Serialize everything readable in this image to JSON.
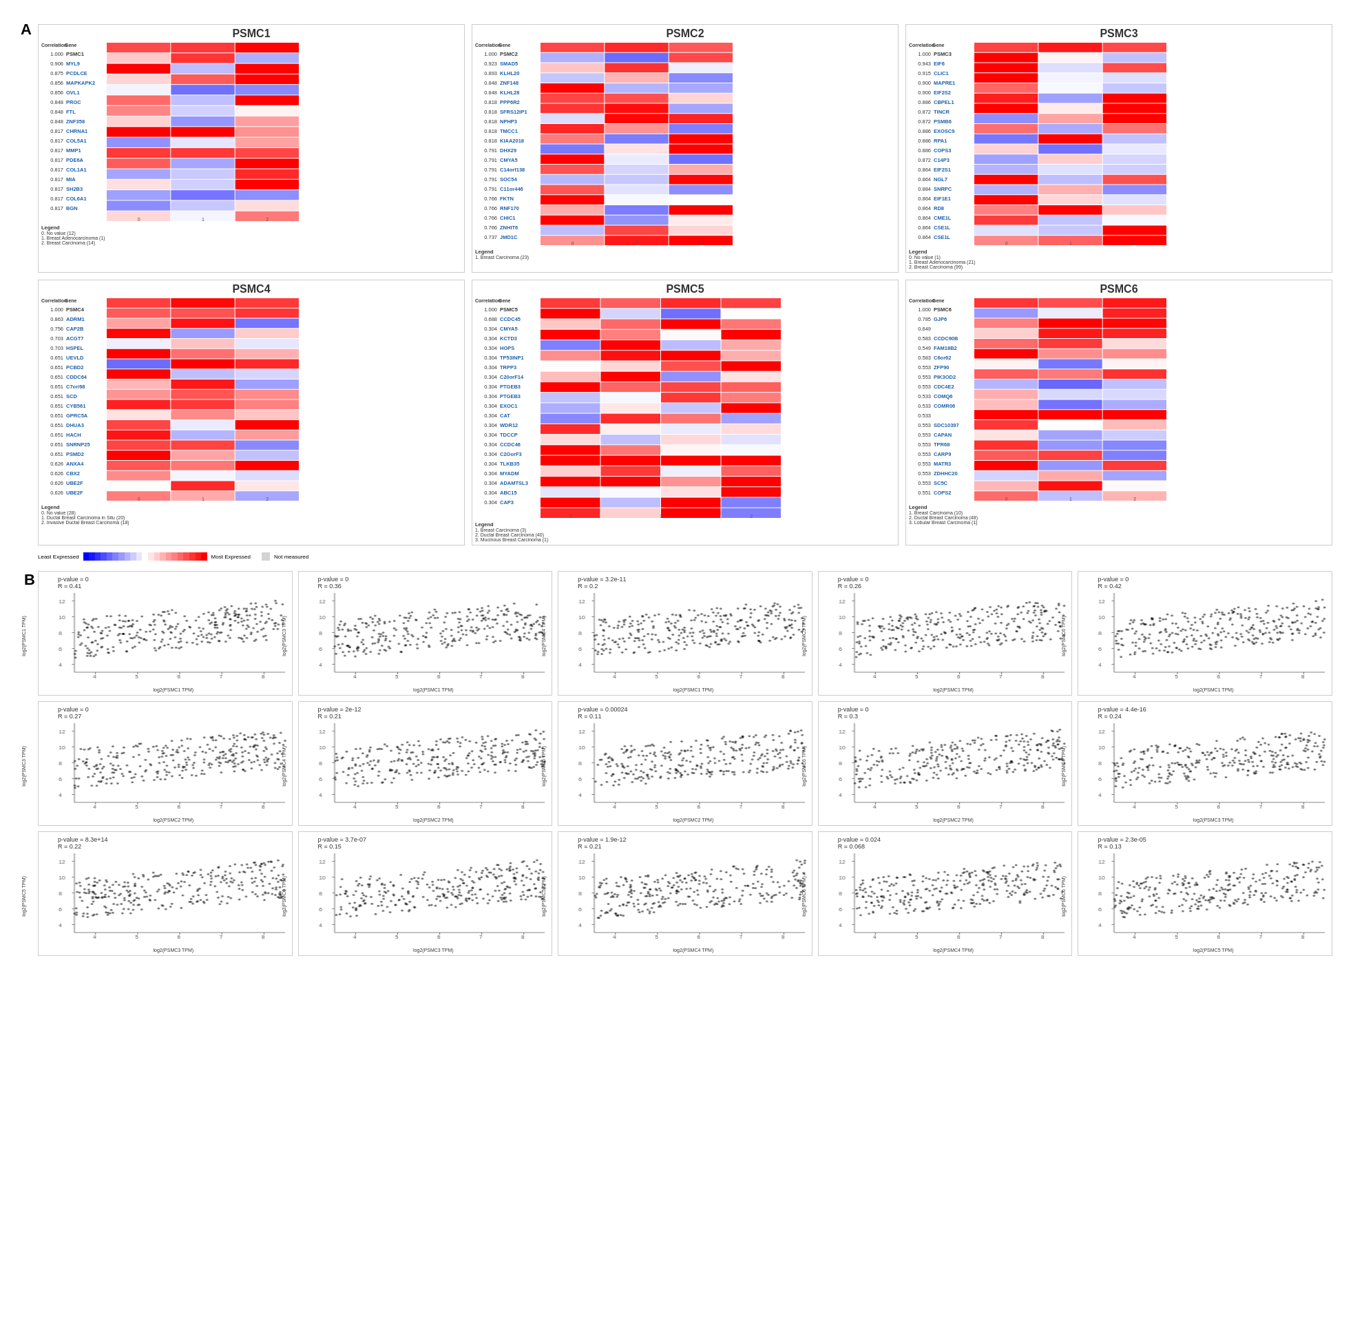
{
  "sectionA": {
    "label": "A",
    "heatmaps": [
      {
        "title": "PSMC1",
        "genes": [
          {
            "corr": "1.000",
            "name": "PSMC1"
          },
          {
            "corr": "0.906",
            "name": "MYL9"
          },
          {
            "corr": "0.875",
            "name": "PCDLCE"
          },
          {
            "corr": "0.856",
            "name": "MAPKAPK2"
          },
          {
            "corr": "0.856",
            "name": "OVL1"
          },
          {
            "corr": "0.848",
            "name": "PROC"
          },
          {
            "corr": "0.848",
            "name": "FTL"
          },
          {
            "corr": "0.848",
            "name": "ZNF358"
          },
          {
            "corr": "0.817",
            "name": "CHRNA1"
          },
          {
            "corr": "0.817",
            "name": "COL5A1"
          },
          {
            "corr": "0.817",
            "name": "MMP1"
          },
          {
            "corr": "0.817",
            "name": "PDE6A"
          },
          {
            "corr": "0.817",
            "name": "COL1A1"
          },
          {
            "corr": "0.817",
            "name": "MIA"
          },
          {
            "corr": "0.817",
            "name": "SH2B3"
          },
          {
            "corr": "0.817",
            "name": "COL6A1"
          },
          {
            "corr": "0.817",
            "name": "BGN"
          }
        ],
        "legend": [
          "0. No value (12)",
          "1. Breast Adenocarcinoma (1)",
          "2. Breast Carcinoma (14)"
        ],
        "cols": 3
      },
      {
        "title": "PSMC2",
        "genes": [
          {
            "corr": "1.000",
            "name": "PSMC2"
          },
          {
            "corr": "0.923",
            "name": "SMAD5"
          },
          {
            "corr": "0.893",
            "name": "KLHL20"
          },
          {
            "corr": "0.848",
            "name": "ZNF148"
          },
          {
            "corr": "0.848",
            "name": "KLHL28"
          },
          {
            "corr": "0.818",
            "name": "PPP6R2"
          },
          {
            "corr": "0.818",
            "name": "SFRS12IP1"
          },
          {
            "corr": "0.818",
            "name": "NPHP3"
          },
          {
            "corr": "0.818",
            "name": "TMCC1"
          },
          {
            "corr": "0.818",
            "name": "KIAA2018"
          },
          {
            "corr": "0.791",
            "name": "DHX29"
          },
          {
            "corr": "0.791",
            "name": "CMYA5"
          },
          {
            "corr": "0.791",
            "name": "C14orf138"
          },
          {
            "corr": "0.791",
            "name": "SOC54"
          },
          {
            "corr": "0.791",
            "name": "C11or446"
          },
          {
            "corr": "0.766",
            "name": "FKTN"
          },
          {
            "corr": "0.766",
            "name": "RNF170"
          },
          {
            "corr": "0.766",
            "name": "CHIC1"
          },
          {
            "corr": "0.766",
            "name": "ZNHIT6"
          },
          {
            "corr": "0.737",
            "name": "JMD1C"
          }
        ],
        "legend": [
          "1. Breast Carcinoma (23)"
        ],
        "cols": 3
      },
      {
        "title": "PSMC3",
        "genes": [
          {
            "corr": "1.000",
            "name": "PSMC3"
          },
          {
            "corr": "0.943",
            "name": "EIF6"
          },
          {
            "corr": "0.915",
            "name": "CLIC1"
          },
          {
            "corr": "0.900",
            "name": "MAPRE1"
          },
          {
            "corr": "0.900",
            "name": "EIF2S2"
          },
          {
            "corr": "0.886",
            "name": "CBPEL1"
          },
          {
            "corr": "0.872",
            "name": "TINCR"
          },
          {
            "corr": "0.872",
            "name": "PSMB6"
          },
          {
            "corr": "0.886",
            "name": "EXOSC9"
          },
          {
            "corr": "0.886",
            "name": "RPA1"
          },
          {
            "corr": "0.886",
            "name": "COPS3"
          },
          {
            "corr": "0.872",
            "name": "C14P3"
          },
          {
            "corr": "0.864",
            "name": "EIF2S1"
          },
          {
            "corr": "0.864",
            "name": "NGL7"
          },
          {
            "corr": "0.884",
            "name": "SNRPC"
          },
          {
            "corr": "0.864",
            "name": "EIF1E1"
          },
          {
            "corr": "0.864",
            "name": "RD8"
          },
          {
            "corr": "0.864",
            "name": "CME1L"
          },
          {
            "corr": "0.864",
            "name": "CSE1L"
          },
          {
            "corr": "0.864",
            "name": "CSE1L"
          }
        ],
        "legend": [
          "0. No value (1)",
          "1. Breast Adenocarcinoma (21)",
          "2. Breast Carcinoma (99)"
        ],
        "cols": 3
      },
      {
        "title": "PSMC4",
        "genes": [
          {
            "corr": "1.000",
            "name": "PSMC4"
          },
          {
            "corr": "0.863",
            "name": "ADRM1"
          },
          {
            "corr": "0.756",
            "name": "CAP2B"
          },
          {
            "corr": "0.703",
            "name": "ACGT7"
          },
          {
            "corr": "0.703",
            "name": "HSPEL"
          },
          {
            "corr": "0.651",
            "name": "UEVLD"
          },
          {
            "corr": "0.651",
            "name": "PCBD2"
          },
          {
            "corr": "0.651",
            "name": "CDDC64"
          },
          {
            "corr": "0.651",
            "name": "C7or/68"
          },
          {
            "corr": "0.651",
            "name": "SCD"
          },
          {
            "corr": "0.651",
            "name": "CYB561"
          },
          {
            "corr": "0.651",
            "name": "GPRC5A"
          },
          {
            "corr": "0.651",
            "name": "DHUA3"
          },
          {
            "corr": "0.651",
            "name": "HACH"
          },
          {
            "corr": "0.651",
            "name": "SNRNP25"
          },
          {
            "corr": "0.651",
            "name": "PSMD2"
          },
          {
            "corr": "0.626",
            "name": "ANXA4"
          },
          {
            "corr": "0.626",
            "name": "CBX2"
          },
          {
            "corr": "0.626",
            "name": "UBE2F"
          },
          {
            "corr": "0.626",
            "name": "UBE2F"
          }
        ],
        "legend": [
          "0. No value (28)",
          "1. Ductal Breast Carcinoma in Situ (20)",
          "2. Invasive Ductal Breast Carcinoma (18)"
        ],
        "cols": 3
      },
      {
        "title": "PSMC5",
        "genes": [
          {
            "corr": "1.000",
            "name": "PSMC5"
          },
          {
            "corr": "0.688",
            "name": "CCDC45"
          },
          {
            "corr": "0.304",
            "name": "CMYA5"
          },
          {
            "corr": "0.304",
            "name": "KCTD3"
          },
          {
            "corr": "0.304",
            "name": "HOPS"
          },
          {
            "corr": "0.304",
            "name": "TP53INP1"
          },
          {
            "corr": "0.304",
            "name": "TRPP3"
          },
          {
            "corr": "0.304",
            "name": "C20orF14"
          },
          {
            "corr": "0.304",
            "name": "PTGEB3"
          },
          {
            "corr": "0.304",
            "name": "PTGEB3"
          },
          {
            "corr": "0.304",
            "name": "EXOC1"
          },
          {
            "corr": "0.304",
            "name": "CAT"
          },
          {
            "corr": "0.304",
            "name": "WDR12"
          },
          {
            "corr": "0.304",
            "name": "TDCCP"
          },
          {
            "corr": "0.304",
            "name": "CCDC46"
          },
          {
            "corr": "0.304",
            "name": "C2OorF3"
          },
          {
            "corr": "0.304",
            "name": "TLKB35"
          },
          {
            "corr": "0.304",
            "name": "MYADM"
          },
          {
            "corr": "0.304",
            "name": "ADAMTSL3"
          },
          {
            "corr": "0.304",
            "name": "ABC15"
          },
          {
            "corr": "0.304",
            "name": "CAP3"
          }
        ],
        "legend": [
          "1. Breast Carcinoma (3)",
          "2. Ductal Breast Carcinoma (40)",
          "3. Mucinous Breast Carcinoma (1)"
        ],
        "cols": 4
      },
      {
        "title": "PSMC6",
        "genes": [
          {
            "corr": "1.000",
            "name": "PSMC6"
          },
          {
            "corr": "0.785",
            "name": "GJP6"
          },
          {
            "corr": "0.649",
            "name": ""
          },
          {
            "corr": "0.583",
            "name": "CCDC90B"
          },
          {
            "corr": "0.549",
            "name": "FAM18B2"
          },
          {
            "corr": "0.583",
            "name": "C6or62"
          },
          {
            "corr": "0.553",
            "name": "ZFP90"
          },
          {
            "corr": "0.553",
            "name": "PIK3OD2"
          },
          {
            "corr": "0.553",
            "name": "CDC4E2"
          },
          {
            "corr": "0.533",
            "name": "COMQ6"
          },
          {
            "corr": "0.533",
            "name": "COMR06"
          },
          {
            "corr": "0.533",
            "name": ""
          },
          {
            "corr": "0.553",
            "name": "SDC10397"
          },
          {
            "corr": "0.553",
            "name": "CAPAN"
          },
          {
            "corr": "0.553",
            "name": "TPR68"
          },
          {
            "corr": "0.553",
            "name": "CARP9"
          },
          {
            "corr": "0.553",
            "name": "MATR3"
          },
          {
            "corr": "0.553",
            "name": "ZDHHC20"
          },
          {
            "corr": "0.553",
            "name": "SC5C"
          },
          {
            "corr": "0.551",
            "name": "COPS2"
          }
        ],
        "legend": [
          "1. Breast Carcinoma (10)",
          "2. Ductal Breast Carcinoma (48)",
          "3. Lobular Breast Carcinoma (1)"
        ],
        "cols": 3
      }
    ]
  },
  "sectionB": {
    "label": "B",
    "scatterRows": [
      [
        {
          "pval": "p-value = 0",
          "r": "R = 0.41",
          "xlabel": "log2(PSMC1 TPM)",
          "ylabel": "log2(PSMC1 TPM)"
        },
        {
          "pval": "p-value = 0",
          "r": "R = 0.36",
          "xlabel": "log2(PSMC1 TPM)",
          "ylabel": "log2(PSMC3 TPM)"
        },
        {
          "pval": "p-value = 3.2e-11",
          "r": "R = 0.2",
          "xlabel": "log2(PSMC1 TPM)",
          "ylabel": "log2(PSMC4 TPM)"
        },
        {
          "pval": "p-value = 0",
          "r": "R = 0.26",
          "xlabel": "log2(PSMC1 TPM)",
          "ylabel": "log2(PSMC5 TPM)"
        },
        {
          "pval": "p-value = 0",
          "r": "R = 0.42",
          "xlabel": "log2(PSMC1 TPM)",
          "ylabel": "log2(PSMC6 TPM)"
        }
      ],
      [
        {
          "pval": "p-value = 0",
          "r": "R = 0.27",
          "xlabel": "log2(PSMC2 TPM)",
          "ylabel": "log2(PSMC3 TPM)"
        },
        {
          "pval": "p-value = 2e-12",
          "r": "R = 0.21",
          "xlabel": "log2(PSMC2 TPM)",
          "ylabel": "log2(PSMC4 TPM)"
        },
        {
          "pval": "p-value = 0.00024",
          "r": "R = 0.11",
          "xlabel": "log2(PSMC2 TPM)",
          "ylabel": "log2(PSMC5 TPM)"
        },
        {
          "pval": "p-value = 0",
          "r": "R = 0.3",
          "xlabel": "log2(PSMC2 TPM)",
          "ylabel": "log2(PSMC6 TPM)"
        },
        {
          "pval": "p-value = 4.4e-16",
          "r": "R = 0.24",
          "xlabel": "log2(PSMC3 TPM)",
          "ylabel": "log2(PSMC4 TPM)"
        }
      ],
      [
        {
          "pval": "p-value = 8.3e+14",
          "r": "R = 0.22",
          "xlabel": "log2(PSMC3 TPM)",
          "ylabel": "log2(PSMC5 TPM)"
        },
        {
          "pval": "p-value = 3.7e-07",
          "r": "R = 0.15",
          "xlabel": "log2(PSMC3 TPM)",
          "ylabel": "log2(PSMC6 TPM)"
        },
        {
          "pval": "p-value = 1.9e-12",
          "r": "R = 0.21",
          "xlabel": "log2(PSMC4 TPM)",
          "ylabel": "log2(PSMC5 TPM)"
        },
        {
          "pval": "p-value = 0.024",
          "r": "R = 0.068",
          "xlabel": "log2(PSMC4 TPM)",
          "ylabel": "log2(PSMC6 TPM)"
        },
        {
          "pval": "p-value = 2.3e-05",
          "r": "R = 0.13",
          "xlabel": "log2(PSMC5 TPM)",
          "ylabel": "log2(PSMC6 TPM)"
        }
      ]
    ]
  },
  "colorScale": {
    "least": "Least Expressed",
    "most": "Most Expressed",
    "notMeasured": "Not measured"
  }
}
